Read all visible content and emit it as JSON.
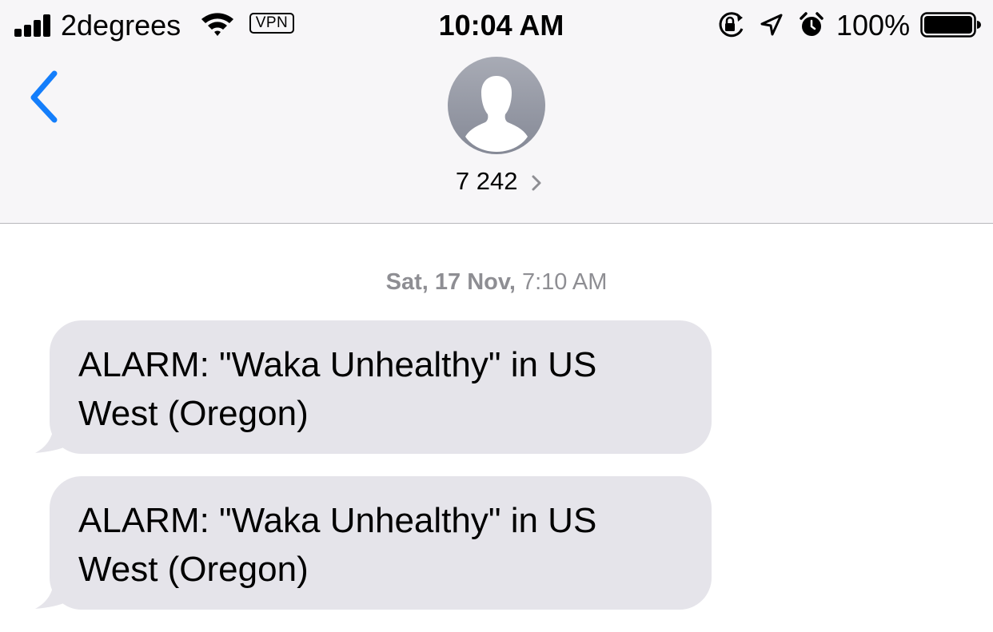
{
  "status_bar": {
    "carrier": "2degrees",
    "vpn_label": "VPN",
    "time": "10:04 AM",
    "battery_percent": "100%",
    "signal_icon": "signal-bars-icon",
    "wifi_icon": "wifi-icon",
    "rotation_lock_icon": "rotation-lock-icon",
    "location_icon": "location-arrow-icon",
    "alarm_icon": "alarm-clock-icon",
    "battery_icon": "battery-icon",
    "battery_level": 1.0
  },
  "nav": {
    "back_icon": "chevron-left-icon",
    "avatar_icon": "person-silhouette-icon",
    "contact_name": "7 242",
    "contact_chevron_icon": "chevron-right-icon",
    "accent_color": "#147efb"
  },
  "conversation": {
    "timestamp_date": "Sat, 17 Nov,",
    "timestamp_time": "7:10 AM",
    "messages": [
      {
        "text": "ALARM: \"Waka Unhealthy\" in US West (Oregon)"
      },
      {
        "text": "ALARM: \"Waka Unhealthy\" in US West (Oregon)"
      }
    ],
    "bubble_color": "#e5e4ea"
  }
}
